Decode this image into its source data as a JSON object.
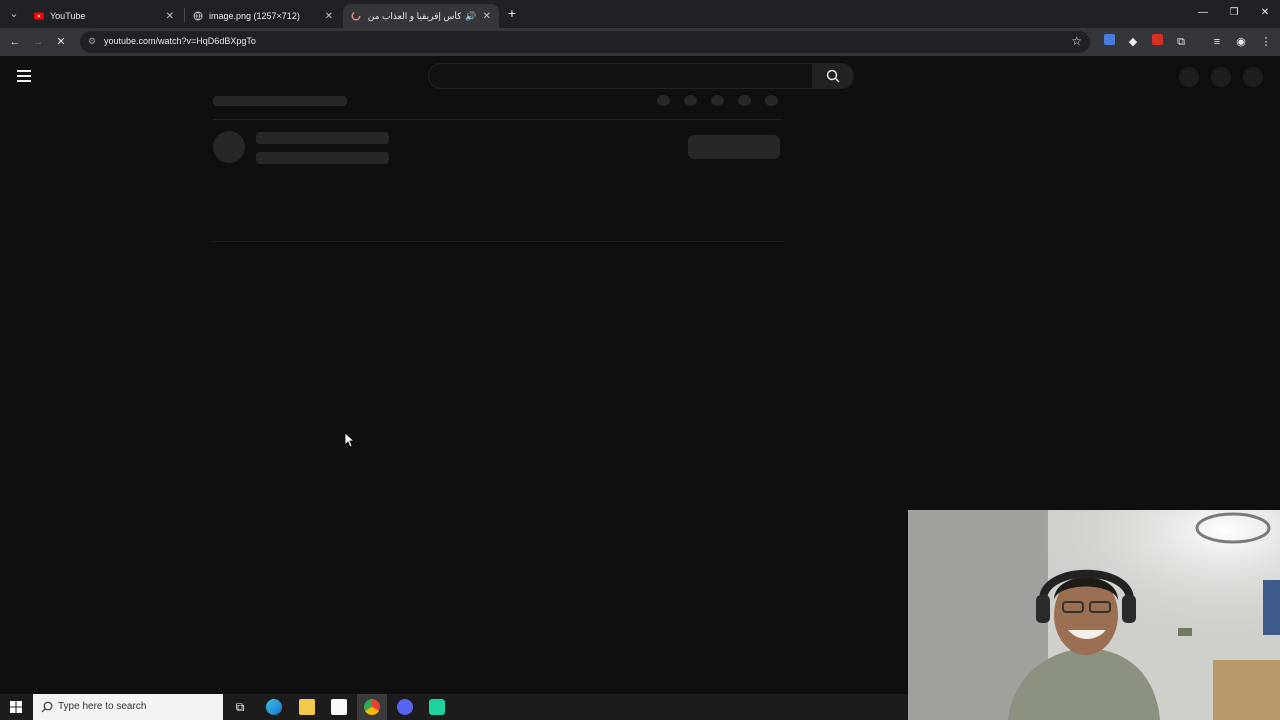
{
  "browser": {
    "tabs": [
      {
        "title": "YouTube",
        "active": false
      },
      {
        "title": "image.png (1257×712)",
        "active": false
      },
      {
        "title": "كأس إفريقيا و العذاب من جد",
        "active": true
      }
    ],
    "url": "youtube.com/watch?v=HqD6dBXpgTo"
  },
  "taskbar": {
    "search_placeholder": "Type here to search"
  },
  "colors": {
    "chrome_dark": "#202124",
    "toolbar": "#35363a",
    "page_bg": "#0f0f0f",
    "skeleton": "#272727",
    "youtube_red": "#ff0000"
  }
}
